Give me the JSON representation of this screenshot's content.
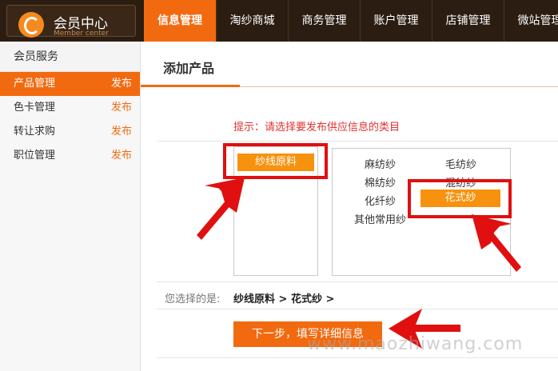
{
  "header": {
    "logo_title": "会员中心",
    "logo_subtitle": "Member center",
    "nav": [
      {
        "label": "信息管理",
        "active": true
      },
      {
        "label": "淘纱商城"
      },
      {
        "label": "商务管理"
      },
      {
        "label": "账户管理"
      },
      {
        "label": "店铺管理"
      },
      {
        "label": "微站管理"
      }
    ]
  },
  "sidebar": {
    "heading": "会员服务",
    "items": [
      {
        "label": "产品管理",
        "action": "发布",
        "active": true
      },
      {
        "label": "色卡管理",
        "action": "发布"
      },
      {
        "label": "转让求购",
        "action": "发布"
      },
      {
        "label": "职位管理",
        "action": "发布"
      }
    ]
  },
  "main": {
    "title": "添加产品",
    "tip": "提示：请选择要发布供应信息的类目",
    "primary_category": "纱线原料",
    "sub_categories": [
      "麻纺纱",
      "毛纺纱",
      "棉纺纱",
      "混纺纱",
      "化纤纱",
      "花式纱",
      "其他常用纱"
    ],
    "selected_sub": "花式纱",
    "chosen_label": "您选择的是:",
    "chosen_value": "纱线原料 > 花式纱 >",
    "next_button": "下一步，填写详细信息"
  },
  "watermark": "www.maozhiwang.com",
  "colors": {
    "topbar": "#2b1d12",
    "accent": "#f26a10",
    "selected": "#f7920f",
    "annotation": "#e01010",
    "tip_text": "#e23232"
  }
}
